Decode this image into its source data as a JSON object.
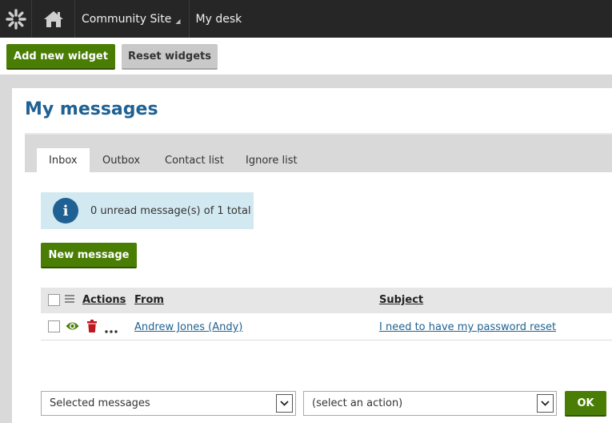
{
  "topbar": {
    "logo_icon": "kentico-logo-icon",
    "home_icon": "home-icon",
    "site_label": "Community Site",
    "desk_label": "My desk"
  },
  "widget_toolbar": {
    "add_label": "Add new widget",
    "reset_label": "Reset widgets"
  },
  "widget": {
    "title": "My messages",
    "tabs": [
      "Inbox",
      "Outbox",
      "Contact list",
      "Ignore list"
    ],
    "active_tab": "Inbox",
    "info_text": "0 unread message(s) of 1 total",
    "new_message_label": "New message",
    "table": {
      "columns": [
        "Actions",
        "From",
        "Subject"
      ],
      "rows": [
        {
          "from": "Andrew Jones (Andy)",
          "subject": "I need to have my password reset"
        }
      ]
    },
    "bottom": {
      "selection": "Selected messages",
      "action": "(select an action)",
      "ok_label": "OK"
    }
  },
  "colors": {
    "accent_green": "#497d04",
    "title_blue": "#1f6193",
    "topbar": "#262626",
    "info_bg": "#d3e9f1",
    "delete_red": "#c0161f"
  }
}
